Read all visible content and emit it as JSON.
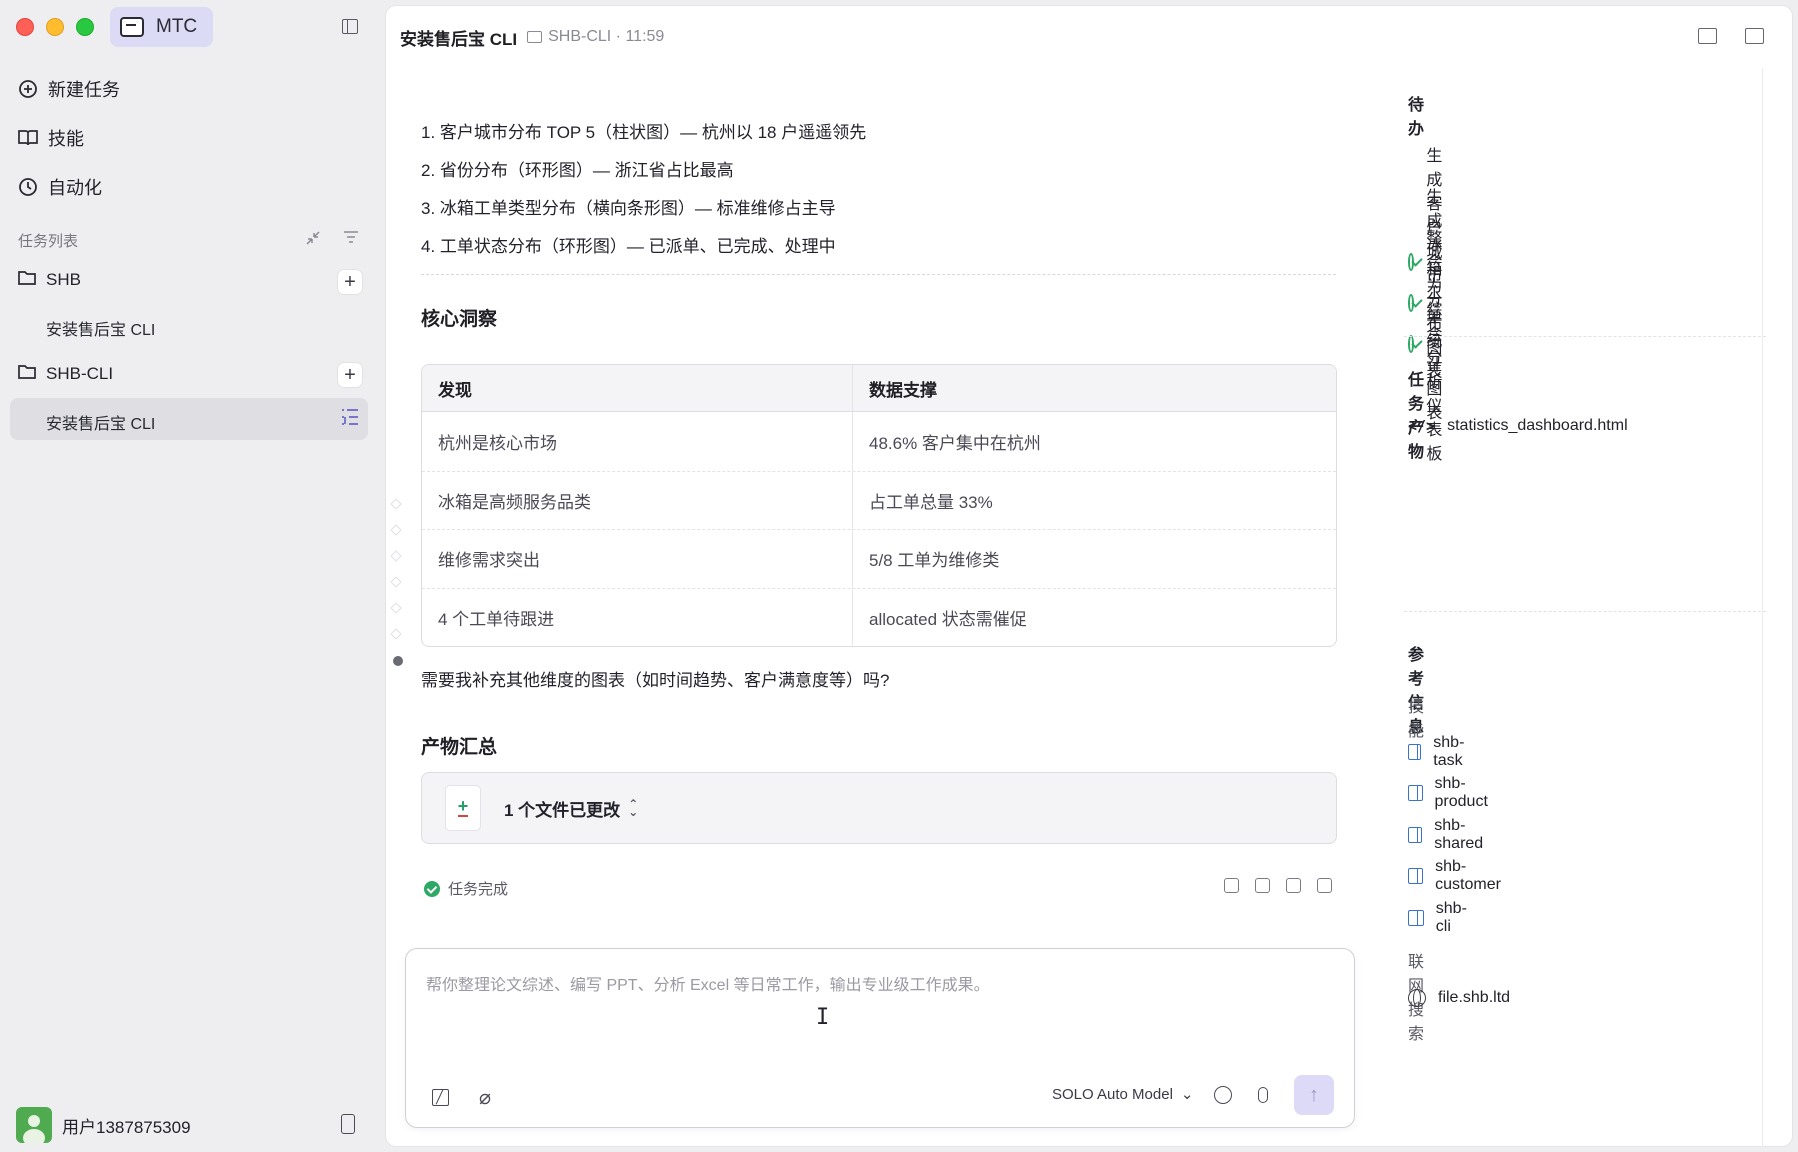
{
  "sidebar": {
    "brand": "MTC",
    "nav": [
      {
        "label": "新建任务",
        "icon": "new-task-icon"
      },
      {
        "label": "技能",
        "icon": "skills-book-icon"
      },
      {
        "label": "自动化",
        "icon": "clock-icon"
      }
    ],
    "section_label": "任务列表",
    "groups": [
      {
        "name": "SHB",
        "tasks": [
          "安装售后宝 CLI"
        ]
      },
      {
        "name": "SHB-CLI",
        "tasks": [
          "安装售后宝 CLI"
        ]
      }
    ],
    "user_name": "用户1387875309"
  },
  "header": {
    "title": "安装售后宝 CLI",
    "crumb": "SHB-CLI · 11:59"
  },
  "content": {
    "list_items": [
      "1. 客户城市分布 TOP 5（柱状图）— 杭州以 18 户遥遥领先",
      "2. 省份分布（环形图）— 浙江省占比最高",
      "3. 冰箱工单类型分布（横向条形图）— 标准维修占主导",
      "4. 工单状态分布（环形图）— 已派单、已完成、处理中"
    ],
    "insights_heading": "核心洞察",
    "table": {
      "headers": [
        "发现",
        "数据支撑"
      ],
      "rows": [
        [
          "杭州是核心市场",
          "48.6% 客户集中在杭州"
        ],
        [
          "冰箱是高频服务品类",
          "占工单总量 33%"
        ],
        [
          "维修需求突出",
          "5/8 工单为维修类"
        ],
        [
          "4 个工单待跟进",
          "allocated 状态需催促"
        ]
      ]
    },
    "question": "需要我补充其他维度的图表（如时间趋势、客户满意度等）吗?",
    "artifacts_heading": "产物汇总",
    "artifact_summary": "1 个文件已更改",
    "status": "任务完成"
  },
  "composer": {
    "placeholder": "帮你整理论文综述、编写 PPT、分析 Excel 等日常工作，输出专业级工作成果。",
    "model": "SOLO Auto Model"
  },
  "right_panel": {
    "todo_title": "待办",
    "todos": [
      "生成客户城市分布图表",
      "生成冰箱工单统计图表",
      "整合为综合分析仪表板"
    ],
    "outputs_title": "任务产物",
    "outputs": [
      "statistics_dashboard.html"
    ],
    "reference_title": "参考信息",
    "skills_label": "技能",
    "skills": [
      "shb-task",
      "shb-product",
      "shb-shared",
      "shb-customer",
      "shb-cli"
    ],
    "search_label": "联网搜索",
    "search_items": [
      "file.shb.ltd"
    ]
  },
  "colors": {
    "accent": "#dcdbf5",
    "success": "#2ea865",
    "link_icon": "#3a72c8"
  }
}
